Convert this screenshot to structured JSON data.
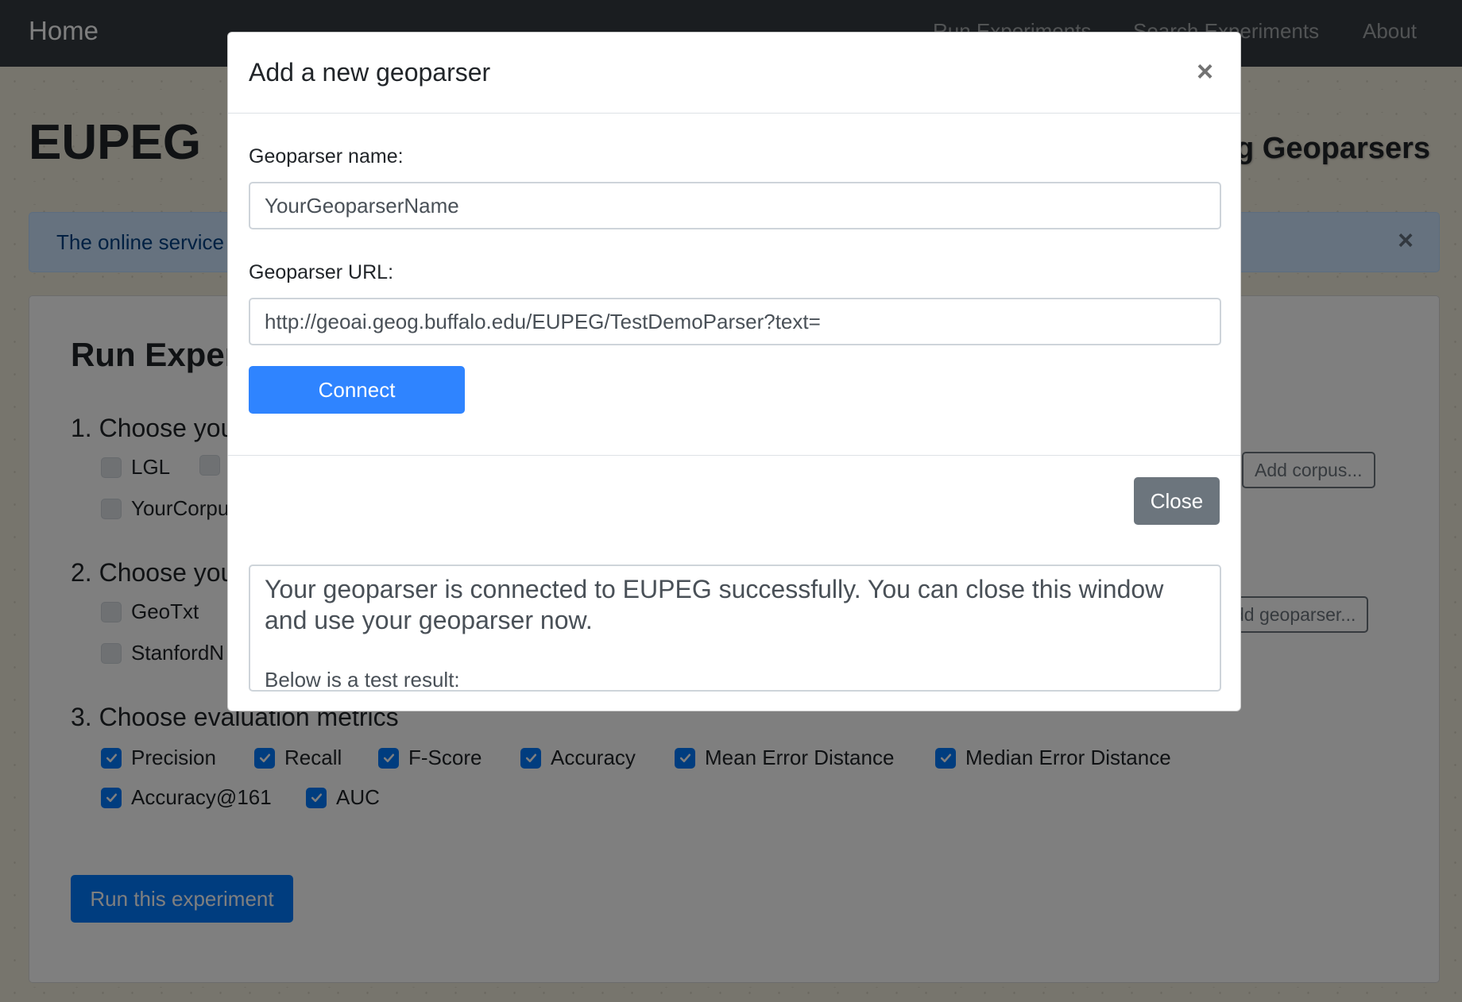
{
  "navbar": {
    "brand": "Home",
    "links": [
      "Run Experiments",
      "Search Experiments",
      "About"
    ]
  },
  "site": {
    "title": "EUPEG",
    "subtitle_visible": "g Geoparsers"
  },
  "alert": {
    "text_visible": "The online service",
    "close": "×"
  },
  "card": {
    "title_visible": "Run Exper",
    "step1_visible": "1. Choose you",
    "corpora_visible": [
      "LGL",
      "YourCorpu"
    ],
    "add_corpus": "Add corpus...",
    "step2_visible": "2. Choose you",
    "geoparsers_visible": [
      "GeoTxt",
      "StanfordN"
    ],
    "add_geoparser_visible": "dd geoparser...",
    "step3": "3. Choose evaluation metrics",
    "metrics": [
      "Precision",
      "Recall",
      "F-Score",
      "Accuracy",
      "Mean Error Distance",
      "Median Error Distance",
      "Accuracy@161",
      "AUC"
    ],
    "run_button": "Run this experiment"
  },
  "modal": {
    "title": "Add a new geoparser",
    "close_icon": "×",
    "name_label": "Geoparser name:",
    "name_value": "YourGeoparserName",
    "url_label": "Geoparser URL:",
    "url_value": "http://geoai.geog.buffalo.edu/EUPEG/TestDemoParser?text=",
    "connect_button": "Connect",
    "close_button": "Close",
    "result_main": "Your geoparser is connected to EUPEG successfully. You can close this window and use your geoparser now.",
    "result_sub": "Below is a test result:"
  },
  "colors": {
    "primary": "#007bff",
    "secondary": "#6c757d",
    "navbar": "#343a40",
    "alert_bg": "#cce5ff"
  }
}
